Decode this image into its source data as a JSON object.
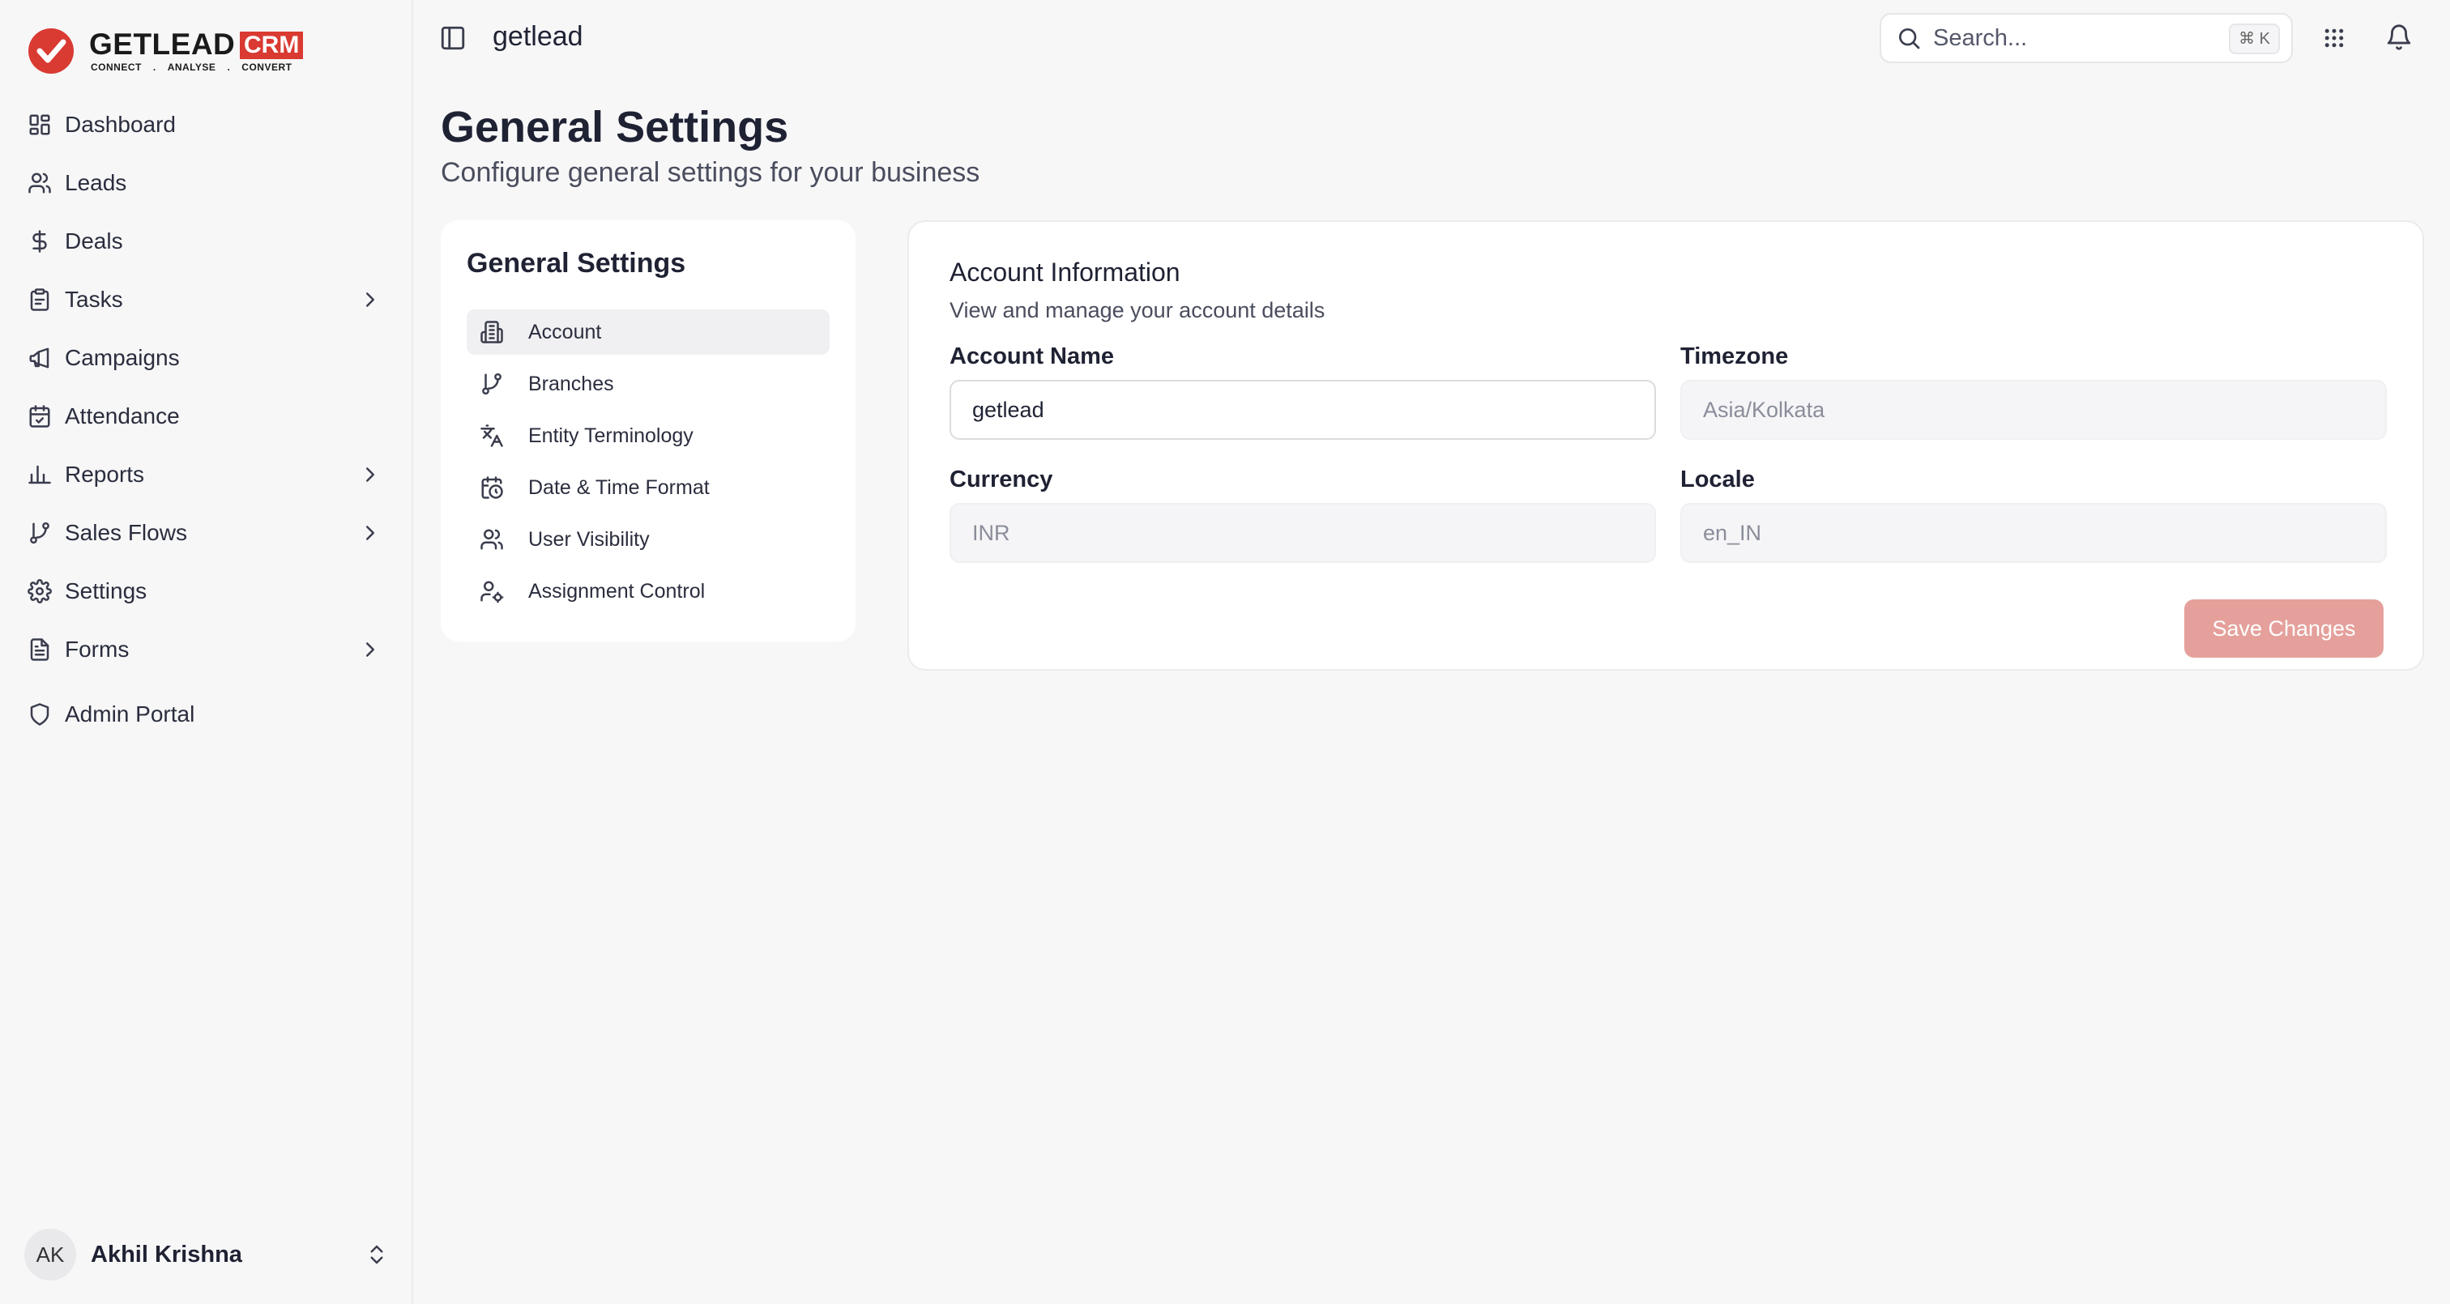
{
  "brand": {
    "name": "GETLEAD",
    "suffix": "CRM",
    "tagline": [
      "CONNECT",
      ".",
      "ANALYSE",
      ".",
      "CONVERT"
    ],
    "accent_color": "#d93a32"
  },
  "sidebar": {
    "items": [
      {
        "label": "Dashboard",
        "icon": "dashboard-grid-icon",
        "has_submenu": false
      },
      {
        "label": "Leads",
        "icon": "users-icon",
        "has_submenu": false
      },
      {
        "label": "Deals",
        "icon": "dollar-icon",
        "has_submenu": false
      },
      {
        "label": "Tasks",
        "icon": "clipboard-icon",
        "has_submenu": true
      },
      {
        "label": "Campaigns",
        "icon": "megaphone-icon",
        "has_submenu": false
      },
      {
        "label": "Attendance",
        "icon": "calendar-check-icon",
        "has_submenu": false
      },
      {
        "label": "Reports",
        "icon": "bar-chart-icon",
        "has_submenu": true
      },
      {
        "label": "Sales Flows",
        "icon": "git-branch-icon",
        "has_submenu": true
      },
      {
        "label": "Settings",
        "icon": "gear-icon",
        "has_submenu": false
      },
      {
        "label": "Forms",
        "icon": "file-text-icon",
        "has_submenu": true
      }
    ],
    "admin_label": "Admin Portal",
    "user": {
      "initials": "AK",
      "name": "Akhil Krishna"
    }
  },
  "header": {
    "workspace": "getlead",
    "search_placeholder": "Search...",
    "search_shortcut": "⌘ K"
  },
  "page": {
    "title": "General Settings",
    "subtitle": "Configure general settings for your business"
  },
  "settings_nav": {
    "title": "General Settings",
    "items": [
      {
        "label": "Account",
        "icon": "building-icon",
        "active": true
      },
      {
        "label": "Branches",
        "icon": "git-branch-icon",
        "active": false
      },
      {
        "label": "Entity Terminology",
        "icon": "translate-icon",
        "active": false
      },
      {
        "label": "Date & Time Format",
        "icon": "calendar-clock-icon",
        "active": false
      },
      {
        "label": "User Visibility",
        "icon": "users-icon",
        "active": false
      },
      {
        "label": "Assignment Control",
        "icon": "user-cog-icon",
        "active": false
      }
    ]
  },
  "account": {
    "title": "Account Information",
    "subtitle": "View and manage your account details",
    "fields": {
      "account_name": {
        "label": "Account Name",
        "value": "getlead",
        "editable": true
      },
      "timezone": {
        "label": "Timezone",
        "value": "Asia/Kolkata",
        "editable": false
      },
      "currency": {
        "label": "Currency",
        "value": "INR",
        "editable": false
      },
      "locale": {
        "label": "Locale",
        "value": "en_IN",
        "editable": false
      }
    },
    "save_label": "Save Changes",
    "save_color": "#e5a09b"
  }
}
